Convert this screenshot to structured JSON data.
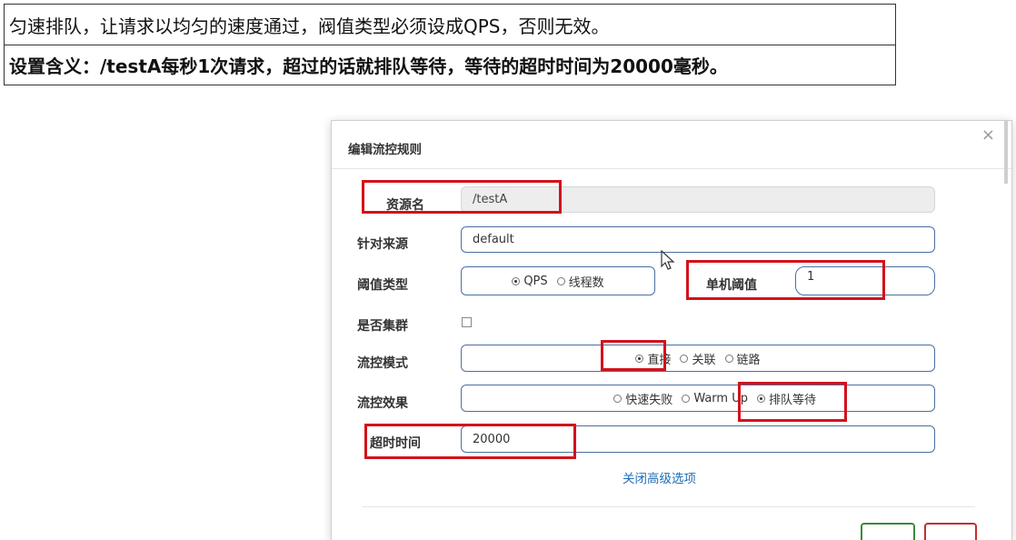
{
  "notes": {
    "line1": "匀速排队，让请求以均匀的速度通过，阀值类型必须设成QPS，否则无效。",
    "line2": "设置含义：/testA每秒1次请求，超过的话就排队等待，等待的超时时间为20000毫秒。"
  },
  "dialog": {
    "title": "编辑流控规则",
    "close_icon": "×",
    "resource": {
      "label": "资源名",
      "value": "/testA"
    },
    "source": {
      "label": "针对来源",
      "value": "default"
    },
    "threshold_type": {
      "label": "阈值类型",
      "options": [
        "QPS",
        "线程数"
      ],
      "selected": "QPS"
    },
    "single_threshold": {
      "label": "单机阈值",
      "value": "1"
    },
    "cluster": {
      "label": "是否集群",
      "checked": false
    },
    "flow_mode": {
      "label": "流控模式",
      "options": [
        "直接",
        "关联",
        "链路"
      ],
      "selected": "直接"
    },
    "flow_effect": {
      "label": "流控效果",
      "options": [
        "快速失败",
        "Warm Up",
        "排队等待"
      ],
      "selected": "排队等待"
    },
    "timeout": {
      "label": "超时时间",
      "value": "20000"
    },
    "advanced_link": "关闭高级选项"
  },
  "highlight_color": "#d3121b"
}
